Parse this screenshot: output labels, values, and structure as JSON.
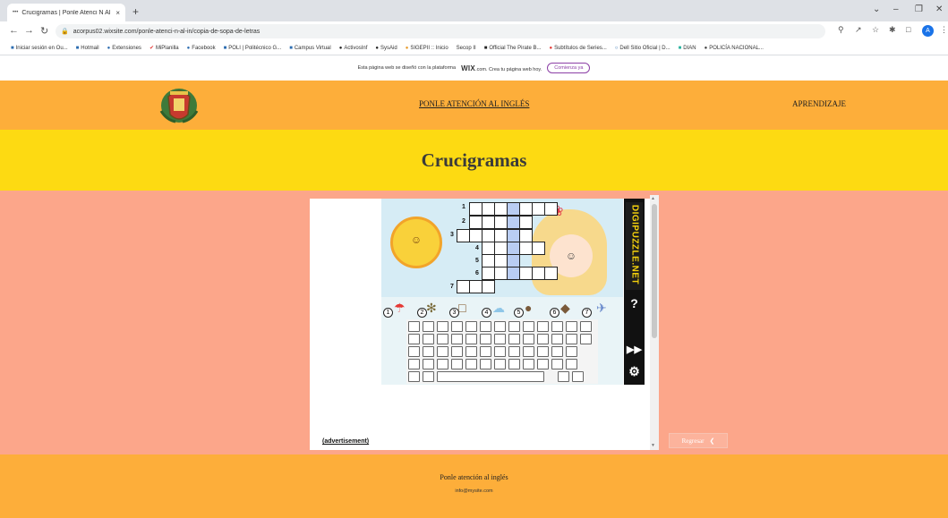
{
  "browser": {
    "tab_title": "Crucigramas | Ponle Atenci N Al …",
    "tab_close": "×",
    "new_tab": "+",
    "url": "acorpus02.wixsite.com/ponle-atenci-n-al-in/copia-de-sopa-de-letras",
    "bookmarks": [
      "Iniciar sesión en Ou...",
      "Hotmail",
      "Extensiones",
      "MiPlanilla",
      "Facebook",
      "POLI | Politécnico G...",
      "Campus Virtual",
      "ActivosInf",
      "SysAid",
      "SIGEPII :: Inicio",
      "Secop II",
      "Official The Pirate B...",
      "Subtítulos de Series...",
      "Dell Sitio Oficial | D...",
      "DIAN",
      "POLICÍA NACIONAL..."
    ],
    "profile_initial": "A"
  },
  "wix_banner": {
    "text_before": "Esta página web se diseñó con la plataforma",
    "brand": "WIX",
    "text_after": ".com. Crea tu página web hoy.",
    "button": "Comienza ya"
  },
  "header": {
    "nav": [
      "PONLE ATENCIÓN AL INGLÉS",
      "APRENDIZAJE"
    ]
  },
  "page": {
    "title": "Crucigramas"
  },
  "game": {
    "brand": "DIGIPUZZLE.NET",
    "row_numbers": [
      "1",
      "2",
      "3",
      "4",
      "5",
      "6",
      "7"
    ],
    "clue_numbers": [
      "1",
      "2",
      "3",
      "4",
      "5",
      "6",
      "7"
    ],
    "side_buttons": [
      "?",
      "▶▶",
      "⚙"
    ]
  },
  "advert_label": "(advertisement)",
  "back_button": {
    "label": "Regresar"
  },
  "footer": {
    "title": "Ponle atención al inglés",
    "email": "info@mysite.com"
  },
  "colors": {
    "header": "#fdae3a",
    "title_band": "#fdda12",
    "main_bg": "#fca68a",
    "highlight_column": "#b9cdf3"
  }
}
